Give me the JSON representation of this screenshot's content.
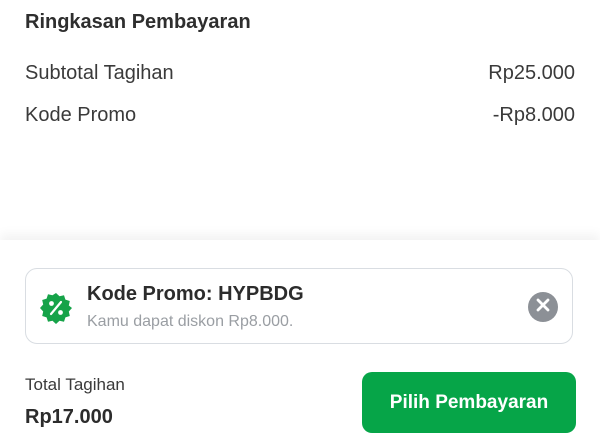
{
  "summary": {
    "title": "Ringkasan Pembayaran",
    "subtotal_label": "Subtotal Tagihan",
    "subtotal_value": "Rp25.000",
    "promo_label": "Kode Promo",
    "promo_value": "-Rp8.000"
  },
  "promo_card": {
    "icon": "discount-badge-icon",
    "code_text": "Kode Promo: HYPBDG",
    "description": "Kamu dapat diskon Rp8.000.",
    "close_icon": "close-icon"
  },
  "footer": {
    "total_label": "Total Tagihan",
    "total_value": "Rp17.000",
    "pay_button_label": "Pilih Pembayaran"
  },
  "colors": {
    "primary_green": "#06a548",
    "badge_green": "#16a349",
    "close_gray": "#8c9096",
    "border_gray": "#d9dde2",
    "muted_text": "#9a9ea3"
  }
}
